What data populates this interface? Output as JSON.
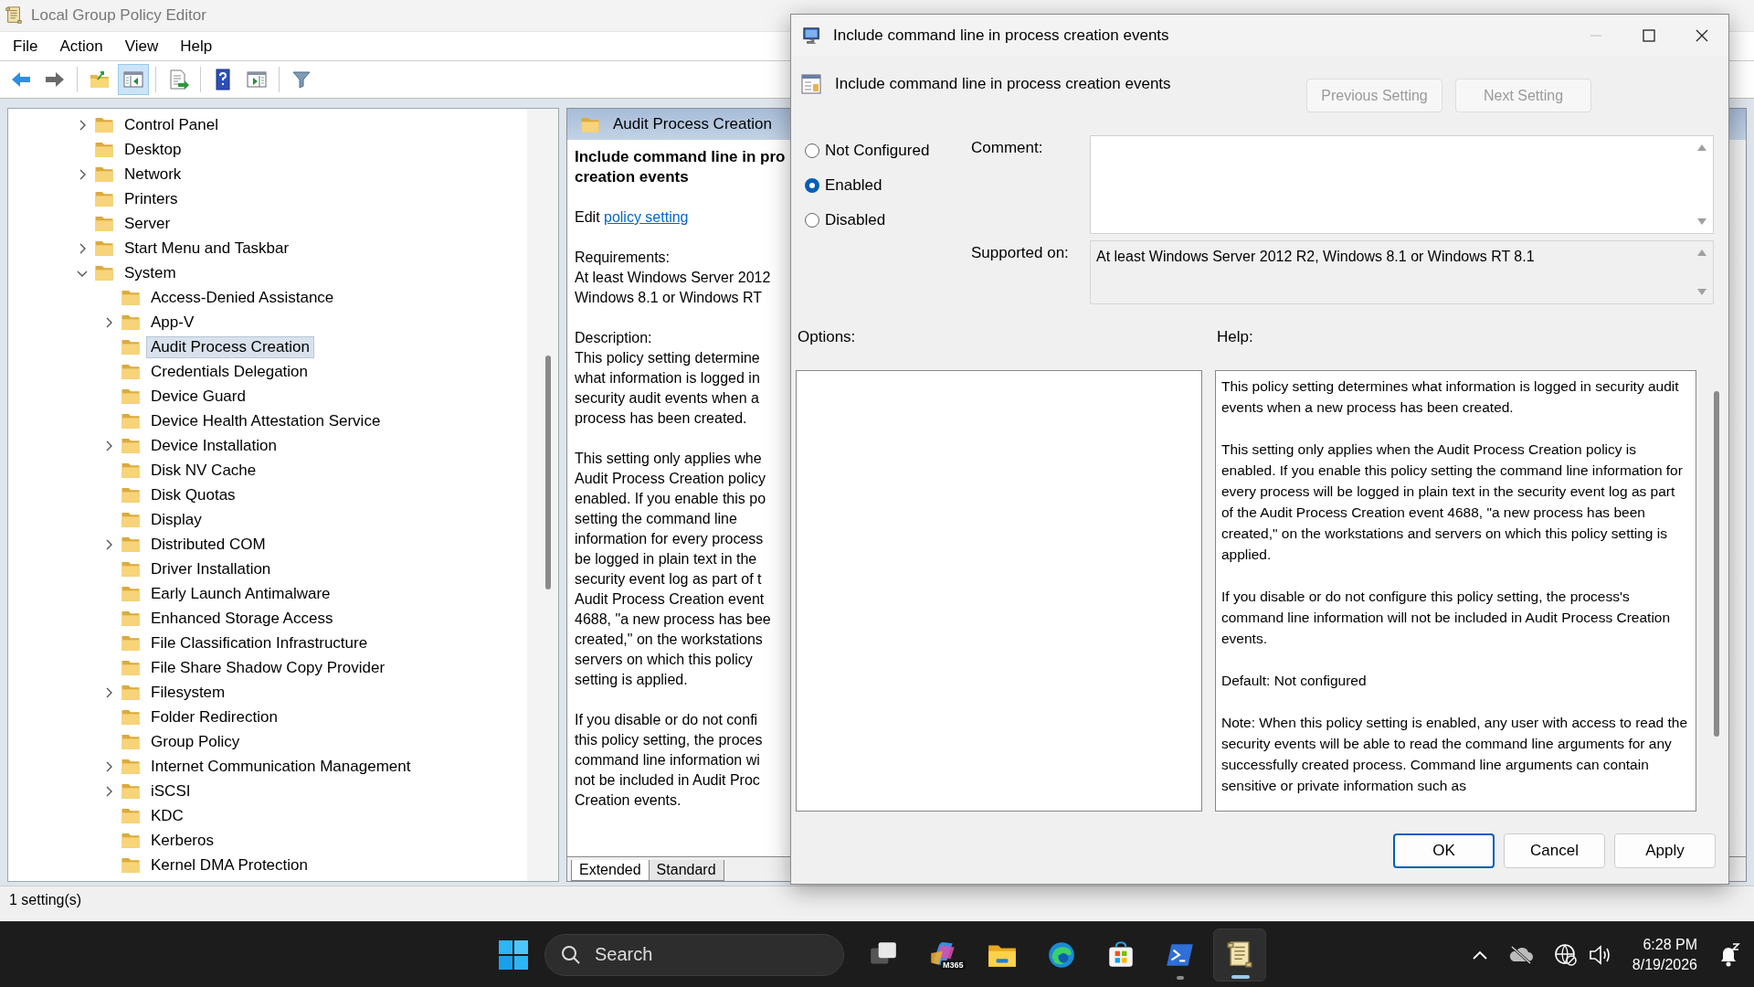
{
  "window": {
    "title": "Local Group Policy Editor"
  },
  "menu": [
    "File",
    "Action",
    "View",
    "Help"
  ],
  "toolbar": [
    [
      {
        "kind": "back",
        "pressed": false
      },
      {
        "kind": "forward",
        "pressed": false
      }
    ],
    [
      {
        "kind": "up",
        "pressed": false
      },
      {
        "kind": "tree",
        "pressed": true
      }
    ],
    [
      {
        "kind": "export",
        "pressed": false
      }
    ],
    [
      {
        "kind": "help",
        "pressed": false
      },
      {
        "kind": "pane",
        "pressed": false
      }
    ],
    [
      {
        "kind": "filter",
        "pressed": false
      }
    ]
  ],
  "tree": {
    "items": [
      {
        "label": "Control Panel",
        "expanded": false,
        "selected": false
      },
      {
        "label": "Desktop",
        "selected": false
      },
      {
        "label": "Network",
        "expanded": false,
        "selected": false
      },
      {
        "label": "Printers",
        "selected": false
      },
      {
        "label": "Server",
        "selected": false
      },
      {
        "label": "Start Menu and Taskbar",
        "expanded": false,
        "selected": false
      },
      {
        "label": "System",
        "expanded": true,
        "selected": false,
        "children": [
          {
            "label": "Access-Denied Assistance",
            "selected": false
          },
          {
            "label": "App-V",
            "expanded": false,
            "selected": false
          },
          {
            "label": "Audit Process Creation",
            "selected": true
          },
          {
            "label": "Credentials Delegation",
            "selected": false
          },
          {
            "label": "Device Guard",
            "selected": false
          },
          {
            "label": "Device Health Attestation Service",
            "selected": false
          },
          {
            "label": "Device Installation",
            "expanded": false,
            "selected": false
          },
          {
            "label": "Disk NV Cache",
            "selected": false
          },
          {
            "label": "Disk Quotas",
            "selected": false
          },
          {
            "label": "Display",
            "selected": false
          },
          {
            "label": "Distributed COM",
            "expanded": false,
            "selected": false
          },
          {
            "label": "Driver Installation",
            "selected": false
          },
          {
            "label": "Early Launch Antimalware",
            "selected": false
          },
          {
            "label": "Enhanced Storage Access",
            "selected": false
          },
          {
            "label": "File Classification Infrastructure",
            "selected": false
          },
          {
            "label": "File Share Shadow Copy Provider",
            "selected": false
          },
          {
            "label": "Filesystem",
            "expanded": false,
            "selected": false
          },
          {
            "label": "Folder Redirection",
            "selected": false
          },
          {
            "label": "Group Policy",
            "selected": false
          },
          {
            "label": "Internet Communication Management",
            "expanded": false,
            "selected": false
          },
          {
            "label": "iSCSI",
            "expanded": false,
            "selected": false
          },
          {
            "label": "KDC",
            "selected": false
          },
          {
            "label": "Kerberos",
            "selected": false
          },
          {
            "label": "Kernel DMA Protection",
            "selected": false
          }
        ]
      }
    ]
  },
  "details": {
    "header": "Audit Process Creation",
    "title_lines": [
      "Include command line in pro",
      "creation events"
    ],
    "edit_label": "Edit",
    "edit_link": "policy setting",
    "paragraphs": [
      [
        "Requirements:",
        "At least Windows Server 2012",
        "Windows 8.1 or Windows RT"
      ],
      [
        "Description:",
        "This policy setting determine",
        "what information is logged in",
        "security audit events when a",
        "process has been created."
      ],
      [
        "This setting only applies whe",
        "Audit Process Creation policy",
        "enabled. If you enable this po",
        "setting the command line",
        "information for every process",
        "be logged in plain text in the",
        "security event log as part of t",
        "Audit Process Creation event",
        "4688, \"a new process has bee",
        "created,\" on the workstations",
        "servers on which this policy",
        "setting is applied."
      ],
      [
        "If you disable or do not confi",
        "this policy setting, the proces",
        "command line information wi",
        "not be included in Audit Proc",
        "Creation events."
      ]
    ],
    "tabs": [
      {
        "label": "Extended",
        "selected": true
      },
      {
        "label": "Standard",
        "selected": false
      }
    ]
  },
  "status_bar": "1 setting(s)",
  "dialog": {
    "title": "Include command line in process creation events",
    "heading": "Include command line in process creation events",
    "nav_buttons": [
      {
        "label": "Previous Setting",
        "disabled": true
      },
      {
        "label": "Next Setting",
        "disabled": true
      }
    ],
    "states": [
      {
        "label": "Not Configured",
        "selected": false
      },
      {
        "label": "Enabled",
        "selected": true
      },
      {
        "label": "Disabled",
        "selected": false
      }
    ],
    "comment_label": "Comment:",
    "supported_label": "Supported on:",
    "supported_value": "At least Windows Server 2012 R2, Windows 8.1 or Windows RT 8.1",
    "options_label": "Options:",
    "help_label": "Help:",
    "help_paragraphs": [
      "This policy setting determines what information is logged in security audit events when a new process has been created.",
      "This setting only applies when the Audit Process Creation policy is enabled. If you enable this policy setting the command line information for every process will be logged in plain text in the security event log as part of the Audit Process Creation event 4688, \"a new process has been created,\" on the workstations and servers on which this policy setting is applied.",
      "If you disable or do not configure this policy setting, the process's command line information will not be included in Audit Process Creation events.",
      "Default: Not configured",
      "Note: When this policy setting is enabled, any user with access to read the security events will be able to read the command line arguments for any successfully created process. Command line arguments can contain sensitive or private information such as"
    ],
    "buttons": [
      {
        "label": "OK",
        "default": true
      },
      {
        "label": "Cancel",
        "default": false
      },
      {
        "label": "Apply",
        "default": false
      }
    ]
  },
  "taskbar": {
    "search_placeholder": "Search",
    "apps": [
      {
        "kind": "taskview",
        "running": false,
        "active": false
      },
      {
        "kind": "m365",
        "badge": "M365",
        "running": false,
        "active": false
      },
      {
        "kind": "explorer",
        "running": false,
        "active": false
      },
      {
        "kind": "edge",
        "running": false,
        "active": false
      },
      {
        "kind": "store",
        "running": false,
        "active": false
      },
      {
        "kind": "terminal",
        "running": true,
        "active": false
      },
      {
        "kind": "gpedit",
        "running": true,
        "active": true
      }
    ],
    "time": "6:28 PM",
    "date": "8/19/2026"
  }
}
